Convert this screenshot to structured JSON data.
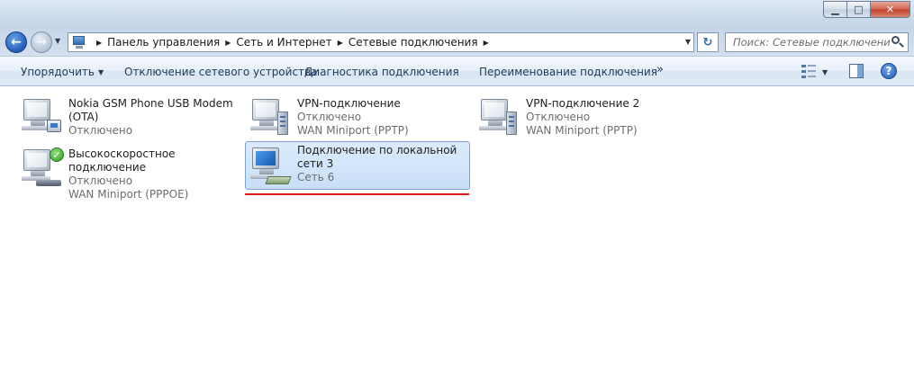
{
  "window": {
    "min_label": "▁",
    "max_label": "□",
    "close_label": "✕"
  },
  "nav": {
    "back_glyph": "←",
    "forward_glyph": "→",
    "history_drop_glyph": "▼"
  },
  "address": {
    "breadcrumbs": [
      "Панель управления",
      "Сеть и Интернет",
      "Сетевые подключения"
    ],
    "separator_glyph": "▶",
    "drop_glyph": "▼",
    "refresh_glyph": "↻"
  },
  "search": {
    "placeholder": "Поиск: Сетевые подключения"
  },
  "commands": {
    "organize": "Упорядочить",
    "disable_device": "Отключение сетевого устройства",
    "diagnose": "Диагностика подключения",
    "rename": "Переименование подключения",
    "more_glyph": "»",
    "caret_glyph": "▼",
    "help_glyph": "?"
  },
  "connections": [
    {
      "name": "Nokia GSM Phone USB Modem (OTA)",
      "status": "Отключено",
      "device": "",
      "icon": "phone-modem-icon"
    },
    {
      "name": "VPN-подключение",
      "status": "Отключено",
      "device": "WAN Miniport (PPTP)",
      "icon": "vpn-icon"
    },
    {
      "name": "VPN-подключение 2",
      "status": "Отключено",
      "device": "WAN Miniport (PPTP)",
      "icon": "vpn-icon"
    },
    {
      "name": "Высокоскоростное подключение",
      "status": "Отключено",
      "device": "WAN Miniport (PPPOE)",
      "icon": "broadband-icon"
    },
    {
      "name": "Подключение по локальной сети 3",
      "status": "Сеть  6",
      "device": "",
      "icon": "lan-icon"
    }
  ],
  "colors": {
    "selection_bg": "#c8dff8",
    "selection_border": "#7da2ce",
    "highlight_underline": "#e11b1b"
  }
}
